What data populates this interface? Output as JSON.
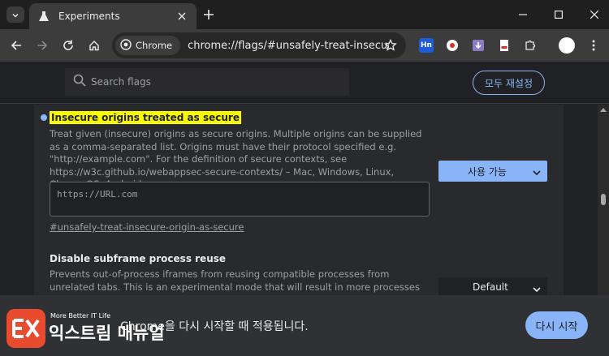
{
  "tab": {
    "title": "Experiments"
  },
  "omnibox": {
    "chip_label": "Chrome",
    "url": "chrome://flags/#unsafely-treat-insecure-or..."
  },
  "extensions": {
    "hn_label": "Hn"
  },
  "search": {
    "placeholder": "Search flags"
  },
  "reset_all_label": "모두 재설정",
  "flags": [
    {
      "title": "Insecure origins treated as secure",
      "description": "Treat given (insecure) origins as secure origins. Multiple origins can be supplied as a comma-separated list. Origins must have their protocol specified e.g. \"http://example.com\". For the definition of secure contexts, see https://w3c.github.io/webappsec-secure-contexts/ – Mac, Windows, Linux, ChromeOS, Android",
      "input_placeholder": "https://URL.com",
      "link": "#unsafely-treat-insecure-origin-as-secure",
      "select_value": "사용 가능"
    },
    {
      "title": "Disable subframe process reuse",
      "description": "Prevents out-of-process iframes from reusing compatible processes from unrelated tabs. This is an experimental mode that will result in more processes being created. – Mac,",
      "select_value": "Default"
    }
  ],
  "bottom": {
    "message": "Chrome을 다시 시작할 때 적용됩니다.",
    "restart_label": "다시 시작"
  },
  "watermark": {
    "tagline": "More Better IT Life",
    "name": "익스트림 매뉴얼"
  },
  "colors": {
    "accent": "#8ab4f8",
    "highlight": "#fcfc00",
    "badge": "#e94b2f"
  }
}
